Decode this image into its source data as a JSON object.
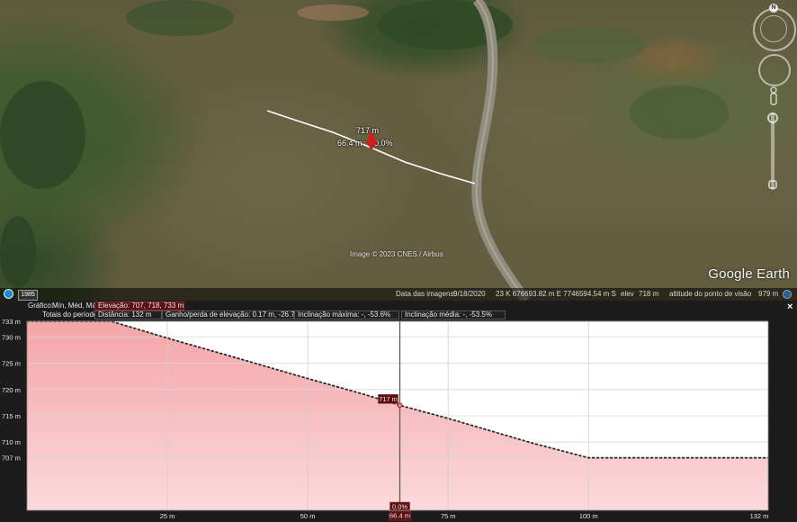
{
  "view": {
    "logo": "Google Earth",
    "image_credit": "Image © 2023 CNES / Airbus",
    "path_label": {
      "elevation": "717 m",
      "distance": "66.4 m",
      "slope": "0.0%"
    },
    "nav_north": "N"
  },
  "status_bar": {
    "history_button": "1985",
    "imagery_date_label": "Data das imagens:",
    "imagery_date": "9/18/2020",
    "coordinates": "23 K 676693.82 m E 7746594.54 m S",
    "elevation_label": "elev",
    "elevation": "718 m",
    "eye_alt_label": "altitude do ponto de visão",
    "eye_alt": "979 m"
  },
  "profile": {
    "row1": {
      "graph_label": "Gráfico:",
      "min_med_max": "Mín, Méd, Máx",
      "elevation": "Elevação: 707, 718, 733 m"
    },
    "row2": {
      "totals_label": "Totais do período:",
      "distance": "Distância: 132 m",
      "gain_loss": "Ganho/perda de elevação: 0.17 m, -26.7 m",
      "max_slope": "Inclinação máxima: -, -53.6%",
      "avg_slope": "Inclinação média: -, -53.5%"
    },
    "close_label": "×",
    "cursor": {
      "elevation_label": "717 m",
      "slope_label": "0.0%",
      "distance_label": "66.4 m"
    },
    "accent_color": "#f5a3a6",
    "label_box_color": "#5a0f12"
  },
  "chart_data": {
    "type": "area",
    "xlabel": "",
    "ylabel": "",
    "xlim": [
      0,
      132
    ],
    "ylim": [
      697,
      733
    ],
    "ytick_labels": [
      "733 m",
      "730 m",
      "725 m",
      "720 m",
      "715 m",
      "710 m",
      "707 m"
    ],
    "ytick_values": [
      733,
      730,
      725,
      720,
      715,
      710,
      707
    ],
    "xtick_labels": [
      "25 m",
      "50 m",
      "75 m",
      "100 m",
      "132 m"
    ],
    "xtick_values": [
      25,
      50,
      75,
      100,
      132
    ],
    "series": [
      {
        "x": [
          0,
          15,
          25,
          40,
          50,
          60,
          66.4,
          75,
          90,
          100,
          105,
          110,
          115,
          120,
          132
        ],
        "y": [
          733,
          733,
          729.8,
          725.2,
          722.1,
          719.1,
          717,
          714.5,
          709.8,
          707,
          707,
          707,
          707,
          707,
          707
        ]
      }
    ],
    "cursor_x": 66.4,
    "cursor_y": 717,
    "grid": true
  }
}
